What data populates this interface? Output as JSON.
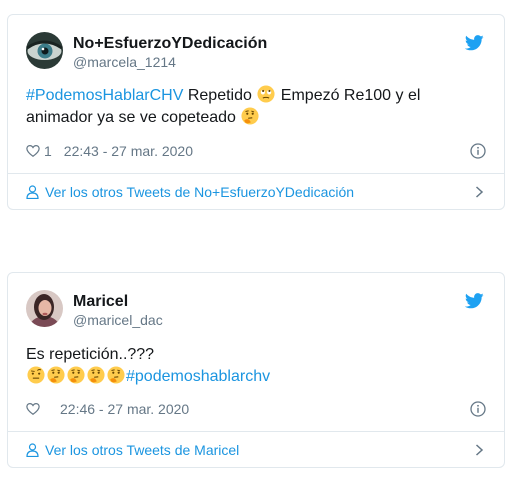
{
  "brand": {
    "accent": "#1b95e0",
    "muted": "#657786",
    "border": "#e1e8ed"
  },
  "tweets": [
    {
      "display_name": "No+EsfuerzoYDedicación",
      "handle": "@marcela_1214",
      "hashtag": "#PodemosHablarCHV",
      "text_part1": " Repetido ",
      "text_part2": " Empezó Re100 y el animador ya se ve copeteado ",
      "emojis": [
        "eye-roll-emoji",
        "thinking-emoji"
      ],
      "like_count": "1",
      "timestamp": "22:43 - 27 mar. 2020",
      "footer_link": "Ver los otros Tweets de No+EsfuerzoYDedicación",
      "icons": {
        "logo": "twitter-bird-icon",
        "like": "heart-icon",
        "info": "info-icon",
        "profile": "person-icon",
        "arrow": "chevron-right-icon"
      }
    },
    {
      "display_name": "Maricel",
      "handle": "@maricel_dac",
      "text_line1": "Es repetición..???",
      "hashtag": "#podemoshablarchv",
      "emojis": [
        "raised-eyebrow-emoji",
        "thinking-emoji",
        "thinking-emoji",
        "thinking-emoji",
        "thinking-emoji"
      ],
      "like_count": "",
      "timestamp": "22:46 - 27 mar. 2020",
      "footer_link": "Ver los otros Tweets de Maricel",
      "icons": {
        "logo": "twitter-bird-icon",
        "like": "heart-icon",
        "info": "info-icon",
        "profile": "person-icon",
        "arrow": "chevron-right-icon"
      }
    }
  ]
}
